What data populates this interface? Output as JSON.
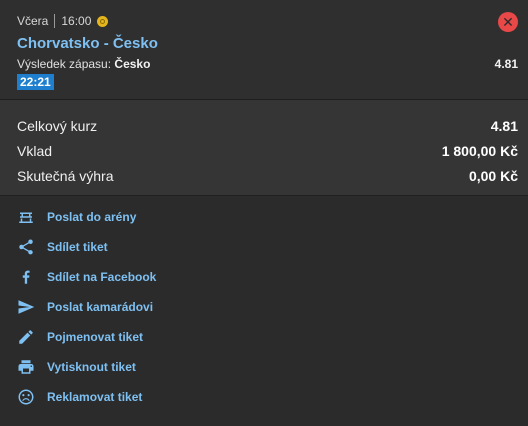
{
  "match": {
    "day": "Včera",
    "time": "16:00",
    "sport_icon": "volleyball-icon",
    "title": "Chorvatsko - Česko",
    "result_label": "Výsledek zápasu:",
    "result_value": "Česko",
    "odd": "4.81",
    "score": "22:21",
    "close_icon": "close-icon"
  },
  "totals": {
    "total_odds_label": "Celkový kurz",
    "total_odds_value": "4.81",
    "stake_label": "Vklad",
    "stake_value": "1 800,00 Kč",
    "win_label": "Skutečná výhra",
    "win_value": "0,00 Kč"
  },
  "actions": [
    {
      "icon": "arena-icon",
      "label": "Poslat do arény"
    },
    {
      "icon": "share-icon",
      "label": "Sdílet tiket"
    },
    {
      "icon": "facebook-icon",
      "label": "Sdílet na Facebook"
    },
    {
      "icon": "send-icon",
      "label": "Poslat kamarádovi"
    },
    {
      "icon": "pencil-icon",
      "label": "Pojmenovat tiket"
    },
    {
      "icon": "printer-icon",
      "label": "Vytisknout tiket"
    },
    {
      "icon": "sad-face-icon",
      "label": "Reklamovat tiket"
    }
  ],
  "colors": {
    "accent": "#7ec0f2",
    "score_bg": "#1e7fcf",
    "close": "#e84848"
  }
}
